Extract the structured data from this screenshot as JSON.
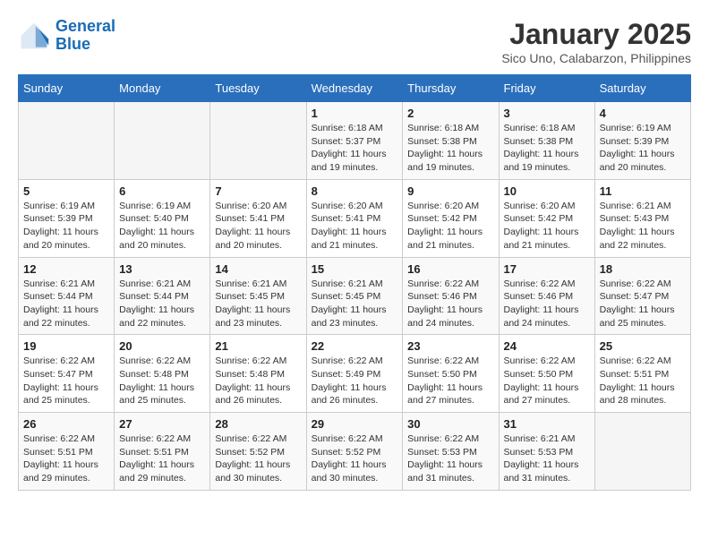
{
  "header": {
    "logo_line1": "General",
    "logo_line2": "Blue",
    "title": "January 2025",
    "subtitle": "Sico Uno, Calabarzon, Philippines"
  },
  "weekdays": [
    "Sunday",
    "Monday",
    "Tuesday",
    "Wednesday",
    "Thursday",
    "Friday",
    "Saturday"
  ],
  "weeks": [
    [
      {
        "day": "",
        "sunrise": "",
        "sunset": "",
        "daylight": ""
      },
      {
        "day": "",
        "sunrise": "",
        "sunset": "",
        "daylight": ""
      },
      {
        "day": "",
        "sunrise": "",
        "sunset": "",
        "daylight": ""
      },
      {
        "day": "1",
        "sunrise": "Sunrise: 6:18 AM",
        "sunset": "Sunset: 5:37 PM",
        "daylight": "Daylight: 11 hours and 19 minutes."
      },
      {
        "day": "2",
        "sunrise": "Sunrise: 6:18 AM",
        "sunset": "Sunset: 5:38 PM",
        "daylight": "Daylight: 11 hours and 19 minutes."
      },
      {
        "day": "3",
        "sunrise": "Sunrise: 6:18 AM",
        "sunset": "Sunset: 5:38 PM",
        "daylight": "Daylight: 11 hours and 19 minutes."
      },
      {
        "day": "4",
        "sunrise": "Sunrise: 6:19 AM",
        "sunset": "Sunset: 5:39 PM",
        "daylight": "Daylight: 11 hours and 20 minutes."
      }
    ],
    [
      {
        "day": "5",
        "sunrise": "Sunrise: 6:19 AM",
        "sunset": "Sunset: 5:39 PM",
        "daylight": "Daylight: 11 hours and 20 minutes."
      },
      {
        "day": "6",
        "sunrise": "Sunrise: 6:19 AM",
        "sunset": "Sunset: 5:40 PM",
        "daylight": "Daylight: 11 hours and 20 minutes."
      },
      {
        "day": "7",
        "sunrise": "Sunrise: 6:20 AM",
        "sunset": "Sunset: 5:41 PM",
        "daylight": "Daylight: 11 hours and 20 minutes."
      },
      {
        "day": "8",
        "sunrise": "Sunrise: 6:20 AM",
        "sunset": "Sunset: 5:41 PM",
        "daylight": "Daylight: 11 hours and 21 minutes."
      },
      {
        "day": "9",
        "sunrise": "Sunrise: 6:20 AM",
        "sunset": "Sunset: 5:42 PM",
        "daylight": "Daylight: 11 hours and 21 minutes."
      },
      {
        "day": "10",
        "sunrise": "Sunrise: 6:20 AM",
        "sunset": "Sunset: 5:42 PM",
        "daylight": "Daylight: 11 hours and 21 minutes."
      },
      {
        "day": "11",
        "sunrise": "Sunrise: 6:21 AM",
        "sunset": "Sunset: 5:43 PM",
        "daylight": "Daylight: 11 hours and 22 minutes."
      }
    ],
    [
      {
        "day": "12",
        "sunrise": "Sunrise: 6:21 AM",
        "sunset": "Sunset: 5:44 PM",
        "daylight": "Daylight: 11 hours and 22 minutes."
      },
      {
        "day": "13",
        "sunrise": "Sunrise: 6:21 AM",
        "sunset": "Sunset: 5:44 PM",
        "daylight": "Daylight: 11 hours and 22 minutes."
      },
      {
        "day": "14",
        "sunrise": "Sunrise: 6:21 AM",
        "sunset": "Sunset: 5:45 PM",
        "daylight": "Daylight: 11 hours and 23 minutes."
      },
      {
        "day": "15",
        "sunrise": "Sunrise: 6:21 AM",
        "sunset": "Sunset: 5:45 PM",
        "daylight": "Daylight: 11 hours and 23 minutes."
      },
      {
        "day": "16",
        "sunrise": "Sunrise: 6:22 AM",
        "sunset": "Sunset: 5:46 PM",
        "daylight": "Daylight: 11 hours and 24 minutes."
      },
      {
        "day": "17",
        "sunrise": "Sunrise: 6:22 AM",
        "sunset": "Sunset: 5:46 PM",
        "daylight": "Daylight: 11 hours and 24 minutes."
      },
      {
        "day": "18",
        "sunrise": "Sunrise: 6:22 AM",
        "sunset": "Sunset: 5:47 PM",
        "daylight": "Daylight: 11 hours and 25 minutes."
      }
    ],
    [
      {
        "day": "19",
        "sunrise": "Sunrise: 6:22 AM",
        "sunset": "Sunset: 5:47 PM",
        "daylight": "Daylight: 11 hours and 25 minutes."
      },
      {
        "day": "20",
        "sunrise": "Sunrise: 6:22 AM",
        "sunset": "Sunset: 5:48 PM",
        "daylight": "Daylight: 11 hours and 25 minutes."
      },
      {
        "day": "21",
        "sunrise": "Sunrise: 6:22 AM",
        "sunset": "Sunset: 5:48 PM",
        "daylight": "Daylight: 11 hours and 26 minutes."
      },
      {
        "day": "22",
        "sunrise": "Sunrise: 6:22 AM",
        "sunset": "Sunset: 5:49 PM",
        "daylight": "Daylight: 11 hours and 26 minutes."
      },
      {
        "day": "23",
        "sunrise": "Sunrise: 6:22 AM",
        "sunset": "Sunset: 5:50 PM",
        "daylight": "Daylight: 11 hours and 27 minutes."
      },
      {
        "day": "24",
        "sunrise": "Sunrise: 6:22 AM",
        "sunset": "Sunset: 5:50 PM",
        "daylight": "Daylight: 11 hours and 27 minutes."
      },
      {
        "day": "25",
        "sunrise": "Sunrise: 6:22 AM",
        "sunset": "Sunset: 5:51 PM",
        "daylight": "Daylight: 11 hours and 28 minutes."
      }
    ],
    [
      {
        "day": "26",
        "sunrise": "Sunrise: 6:22 AM",
        "sunset": "Sunset: 5:51 PM",
        "daylight": "Daylight: 11 hours and 29 minutes."
      },
      {
        "day": "27",
        "sunrise": "Sunrise: 6:22 AM",
        "sunset": "Sunset: 5:51 PM",
        "daylight": "Daylight: 11 hours and 29 minutes."
      },
      {
        "day": "28",
        "sunrise": "Sunrise: 6:22 AM",
        "sunset": "Sunset: 5:52 PM",
        "daylight": "Daylight: 11 hours and 30 minutes."
      },
      {
        "day": "29",
        "sunrise": "Sunrise: 6:22 AM",
        "sunset": "Sunset: 5:52 PM",
        "daylight": "Daylight: 11 hours and 30 minutes."
      },
      {
        "day": "30",
        "sunrise": "Sunrise: 6:22 AM",
        "sunset": "Sunset: 5:53 PM",
        "daylight": "Daylight: 11 hours and 31 minutes."
      },
      {
        "day": "31",
        "sunrise": "Sunrise: 6:21 AM",
        "sunset": "Sunset: 5:53 PM",
        "daylight": "Daylight: 11 hours and 31 minutes."
      },
      {
        "day": "",
        "sunrise": "",
        "sunset": "",
        "daylight": ""
      }
    ]
  ]
}
